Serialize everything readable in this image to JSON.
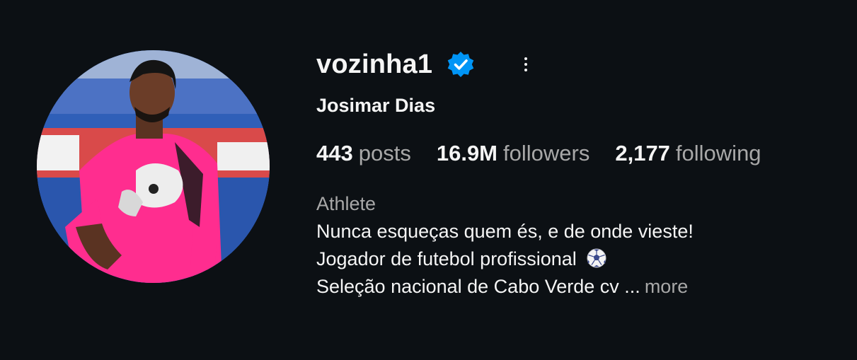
{
  "profile": {
    "username": "vozinha1",
    "verified_icon": "verified-badge-icon",
    "options_icon": "more-options-icon",
    "full_name": "Josimar Dias",
    "stats": {
      "posts_count": "443",
      "posts_label": "posts",
      "followers_count": "16.9M",
      "followers_label": "followers",
      "following_count": "2,177",
      "following_label": "following"
    },
    "bio": {
      "category": "Athlete",
      "line1": "Nunca esqueças quem és, e de onde vieste!",
      "line2": "Jogador de futebol profissional",
      "line2_icon": "soccer-ball-icon",
      "line3": "Seleção nacional de Cabo Verde cv ...",
      "more_label": "more"
    }
  },
  "colors": {
    "background": "#0c1014",
    "text_primary": "#f5f5f5",
    "text_secondary": "#a8a8a8",
    "verified_blue": "#0095f6",
    "jersey_pink": "#ff2d8f"
  }
}
